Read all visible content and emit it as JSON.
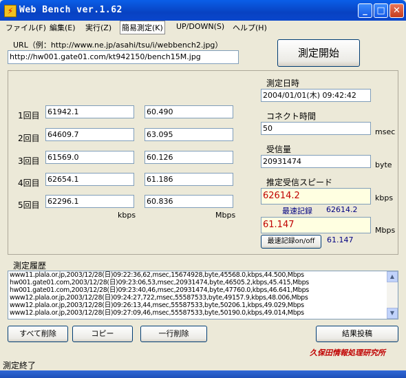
{
  "window": {
    "title": "Web Bench ver.1.62",
    "minimize": "_",
    "maximize": "□",
    "close": "✕"
  },
  "menu": [
    "ファイル(F)",
    "編集(E)",
    "実行(Z)",
    "簡易測定(K)",
    "UP/DOWN(S)",
    "ヘルプ(H)"
  ],
  "url": {
    "label": "URL（例：http://www.ne.jp/asahi/tsu/i/webbench2.jpg）",
    "value": "http://hw001.gate01.com/kt942150/bench15M.jpg"
  },
  "start_button": "測定開始",
  "runs": [
    {
      "label": "1回目",
      "kbps": "61942.1",
      "mbps": "60.490"
    },
    {
      "label": "2回目",
      "kbps": "64609.7",
      "mbps": "63.095"
    },
    {
      "label": "3回目",
      "kbps": "61569.0",
      "mbps": "60.126"
    },
    {
      "label": "4回目",
      "kbps": "62654.1",
      "mbps": "61.186"
    },
    {
      "label": "5回目",
      "kbps": "62296.1",
      "mbps": "60.836"
    }
  ],
  "units": {
    "kbps": "kbps",
    "mbps": "Mbps",
    "msec": "msec",
    "byte": "byte"
  },
  "measure_datetime": {
    "label": "測定日時",
    "value": "2004/01/01(木) 09:42:42"
  },
  "connect_time": {
    "label": "コネクト時間",
    "value": "50"
  },
  "received": {
    "label": "受信量",
    "value": "20931474"
  },
  "estimated_speed": {
    "label": "推定受信スピード",
    "kbps": "62614.2",
    "best_label": "最速記録",
    "best_kbps": "62614.2",
    "mbps": "61.147",
    "best_mbps": "61.147",
    "best_toggle": "最速記録on/off"
  },
  "history": {
    "label": "測定履歴",
    "lines": [
      "www11.plala.or.jp,2003/12/28(日)09:22:36,62,msec,15674928,byte,45568.0,kbps,44.500,Mbps",
      "hw001.gate01.com,2003/12/28(日)09:23:06,53,msec,20931474,byte,46505.2,kbps,45.415,Mbps",
      "hw001.gate01.com,2003/12/28(日)09:23:40,46,msec,20931474,byte,47760.0,kbps,46.641,Mbps",
      "www12.plala.or.jp,2003/12/28(日)09:24:27,722,msec,55587533,byte,49157.9,kbps,48.006,Mbps",
      "www12.plala.or.jp,2003/12/28(日)09:26:13,44,msec,55587533,byte,50206.1,kbps,49.029,Mbps",
      "www12.plala.or.jp,2003/12/28(日)09:27:09,46,msec,55587533,byte,50190.0,kbps,49.014,Mbps"
    ]
  },
  "buttons": {
    "delete_all": "すべて削除",
    "copy": "コピー",
    "delete_line": "一行削除",
    "post_result": "結果投稿"
  },
  "credit": "久保田情報処理研究所",
  "status": "測定終了",
  "colors": {
    "accent_red": "#c00000",
    "title_blue": "#0a46cc",
    "best_blue": "#000080"
  }
}
